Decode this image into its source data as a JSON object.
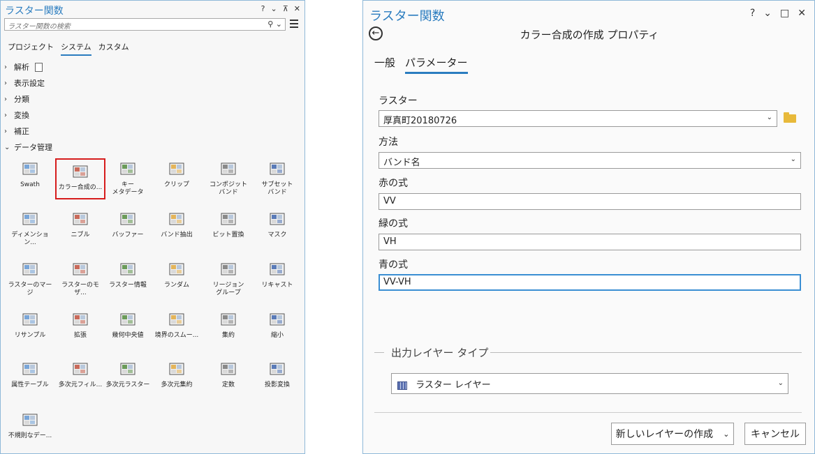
{
  "left": {
    "title": "ラスター関数",
    "window_controls": [
      "?",
      "⌄",
      "⊼",
      "✕"
    ],
    "search_placeholder": "ラスター関数の検索",
    "tabs": [
      "プロジェクト",
      "システム",
      "カスタム"
    ],
    "active_tab": "システム",
    "tree": [
      {
        "label": "解析",
        "expanded": false
      },
      {
        "label": "表示設定",
        "expanded": false
      },
      {
        "label": "分類",
        "expanded": false
      },
      {
        "label": "変換",
        "expanded": false
      },
      {
        "label": "補正",
        "expanded": false
      },
      {
        "label": "データ管理",
        "expanded": true
      }
    ],
    "tiles": [
      {
        "label": "Swath",
        "icon": "swath-icon"
      },
      {
        "label": "カラー合成の...",
        "icon": "composite-color-icon",
        "selected": true
      },
      {
        "label": "キー\nメタデータ",
        "icon": "key-metadata-icon"
      },
      {
        "label": "クリップ",
        "icon": "clip-icon"
      },
      {
        "label": "コンポジット\nバンド",
        "icon": "composite-bands-icon"
      },
      {
        "label": "サブセット\nバンド",
        "icon": "subset-bands-icon"
      },
      {
        "label": "ディメンション...",
        "icon": "dimension-icon"
      },
      {
        "label": "ニブル",
        "icon": "nibble-icon"
      },
      {
        "label": "バッファー",
        "icon": "buffer-icon"
      },
      {
        "label": "バンド抽出",
        "icon": "extract-bands-icon"
      },
      {
        "label": "ビット置換",
        "icon": "bit-replace-icon"
      },
      {
        "label": "マスク",
        "icon": "mask-icon"
      },
      {
        "label": "ラスターのマージ",
        "icon": "merge-rasters-icon"
      },
      {
        "label": "ラスターのモザ...",
        "icon": "mosaic-rasters-icon"
      },
      {
        "label": "ラスター情報",
        "icon": "raster-info-icon"
      },
      {
        "label": "ランダム",
        "icon": "random-icon"
      },
      {
        "label": "リージョン\nグループ",
        "icon": "region-group-icon"
      },
      {
        "label": "リキャスト",
        "icon": "recast-icon"
      },
      {
        "label": "リサンプル",
        "icon": "resample-icon"
      },
      {
        "label": "拡張",
        "icon": "expand-icon"
      },
      {
        "label": "幾何中央値",
        "icon": "geometric-median-icon"
      },
      {
        "label": "境界のスムー...",
        "icon": "boundary-smooth-icon"
      },
      {
        "label": "集約",
        "icon": "aggregate-icon"
      },
      {
        "label": "縮小",
        "icon": "shrink-icon"
      },
      {
        "label": "属性テーブル",
        "icon": "attribute-table-icon"
      },
      {
        "label": "多次元フィル...",
        "icon": "md-filter-icon"
      },
      {
        "label": "多次元ラスター",
        "icon": "md-raster-icon"
      },
      {
        "label": "多次元集約",
        "icon": "md-aggregate-icon"
      },
      {
        "label": "定数",
        "icon": "constant-icon"
      },
      {
        "label": "投影変換",
        "icon": "reproject-icon"
      },
      {
        "label": "不規則なデー...",
        "icon": "irregular-data-icon"
      }
    ]
  },
  "right": {
    "title": "ラスター関数",
    "window_controls": [
      "?",
      "⌄",
      "□",
      "✕"
    ],
    "heading": "カラー合成の作成 プロパティ",
    "tabs": [
      "一般",
      "パラメーター"
    ],
    "active_tab": "パラメーター",
    "raster_label": "ラスター",
    "raster_value": "厚真町20180726",
    "method_label": "方法",
    "method_value": "バンド名",
    "red_label": "赤の式",
    "red_value": "VV",
    "green_label": "緑の式",
    "green_value": "VH",
    "blue_label": "青の式",
    "blue_value": "VV-VH",
    "output_section_label": "出力レイヤー タイプ",
    "output_type_value": "ラスター レイヤー",
    "create_button": "新しいレイヤーの作成",
    "cancel_button": "キャンセル"
  }
}
